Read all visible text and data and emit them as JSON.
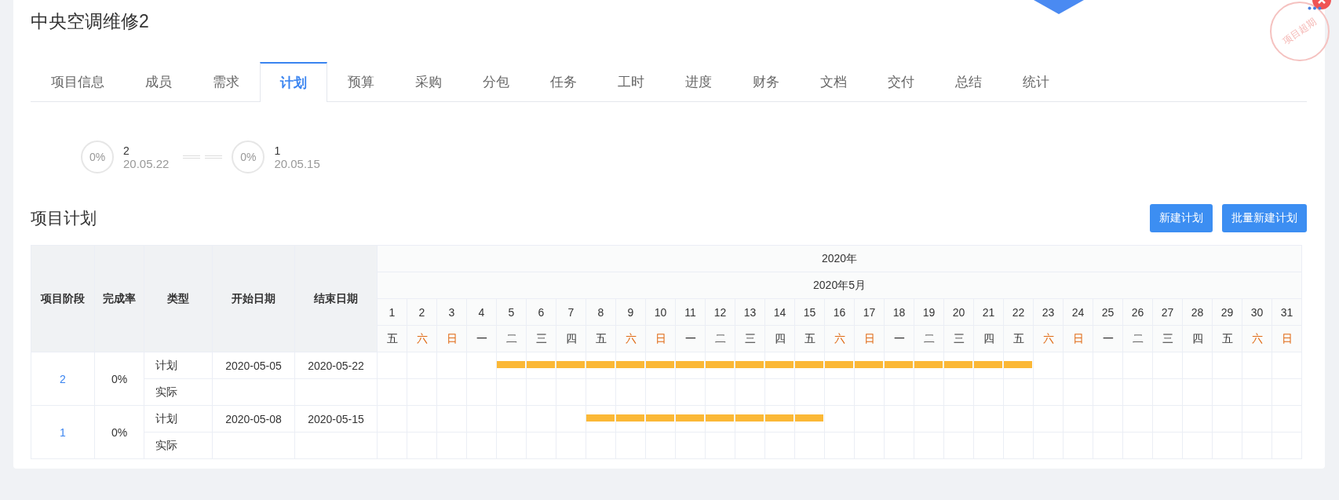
{
  "project": {
    "title": "中央空调维修2",
    "stamp": "项目超期"
  },
  "tabs": [
    {
      "label": "项目信息",
      "selected": false
    },
    {
      "label": "成员",
      "selected": false
    },
    {
      "label": "需求",
      "selected": false
    },
    {
      "label": "计划",
      "selected": true
    },
    {
      "label": "预算",
      "selected": false
    },
    {
      "label": "采购",
      "selected": false
    },
    {
      "label": "分包",
      "selected": false
    },
    {
      "label": "任务",
      "selected": false
    },
    {
      "label": "工时",
      "selected": false
    },
    {
      "label": "进度",
      "selected": false
    },
    {
      "label": "财务",
      "selected": false
    },
    {
      "label": "文档",
      "selected": false
    },
    {
      "label": "交付",
      "selected": false
    },
    {
      "label": "总结",
      "selected": false
    },
    {
      "label": "统计",
      "selected": false
    }
  ],
  "milestones": [
    {
      "percent": "0%",
      "name": "2",
      "date": "20.05.22"
    },
    {
      "percent": "0%",
      "name": "1",
      "date": "20.05.15"
    }
  ],
  "section": {
    "title": "项目计划",
    "buttons": [
      "新建计划",
      "批量新建计划"
    ]
  },
  "table": {
    "columns": [
      "项目阶段",
      "完成率",
      "类型",
      "开始日期",
      "结束日期"
    ],
    "year": "2020年",
    "month": "2020年5月",
    "days": [
      {
        "day": "1",
        "weekday": "五",
        "weekend": false
      },
      {
        "day": "2",
        "weekday": "六",
        "weekend": true
      },
      {
        "day": "3",
        "weekday": "日",
        "weekend": true
      },
      {
        "day": "4",
        "weekday": "一",
        "weekend": false
      },
      {
        "day": "5",
        "weekday": "二",
        "weekend": false
      },
      {
        "day": "6",
        "weekday": "三",
        "weekend": false
      },
      {
        "day": "7",
        "weekday": "四",
        "weekend": false
      },
      {
        "day": "8",
        "weekday": "五",
        "weekend": false
      },
      {
        "day": "9",
        "weekday": "六",
        "weekend": true
      },
      {
        "day": "10",
        "weekday": "日",
        "weekend": true
      },
      {
        "day": "11",
        "weekday": "一",
        "weekend": false
      },
      {
        "day": "12",
        "weekday": "二",
        "weekend": false
      },
      {
        "day": "13",
        "weekday": "三",
        "weekend": false
      },
      {
        "day": "14",
        "weekday": "四",
        "weekend": false
      },
      {
        "day": "15",
        "weekday": "五",
        "weekend": false
      },
      {
        "day": "16",
        "weekday": "六",
        "weekend": true
      },
      {
        "day": "17",
        "weekday": "日",
        "weekend": true
      },
      {
        "day": "18",
        "weekday": "一",
        "weekend": false
      },
      {
        "day": "19",
        "weekday": "二",
        "weekend": false
      },
      {
        "day": "20",
        "weekday": "三",
        "weekend": false
      },
      {
        "day": "21",
        "weekday": "四",
        "weekend": false
      },
      {
        "day": "22",
        "weekday": "五",
        "weekend": false
      },
      {
        "day": "23",
        "weekday": "六",
        "weekend": true
      },
      {
        "day": "24",
        "weekday": "日",
        "weekend": true
      },
      {
        "day": "25",
        "weekday": "一",
        "weekend": false
      },
      {
        "day": "26",
        "weekday": "二",
        "weekend": false
      },
      {
        "day": "27",
        "weekday": "三",
        "weekend": false
      },
      {
        "day": "28",
        "weekday": "四",
        "weekend": false
      },
      {
        "day": "29",
        "weekday": "五",
        "weekend": false
      },
      {
        "day": "30",
        "weekday": "六",
        "weekend": true
      },
      {
        "day": "31",
        "weekday": "日",
        "weekend": true
      }
    ],
    "phases": [
      {
        "name": "2",
        "completion": "0%",
        "rows": [
          {
            "type": "计划",
            "start": "2020-05-05",
            "end": "2020-05-22"
          },
          {
            "type": "实际"
          }
        ]
      },
      {
        "name": "1",
        "completion": "0%",
        "rows": [
          {
            "type": "计划",
            "start": "2020-05-08",
            "end": "2020-05-15"
          },
          {
            "type": "实际"
          }
        ]
      }
    ]
  }
}
